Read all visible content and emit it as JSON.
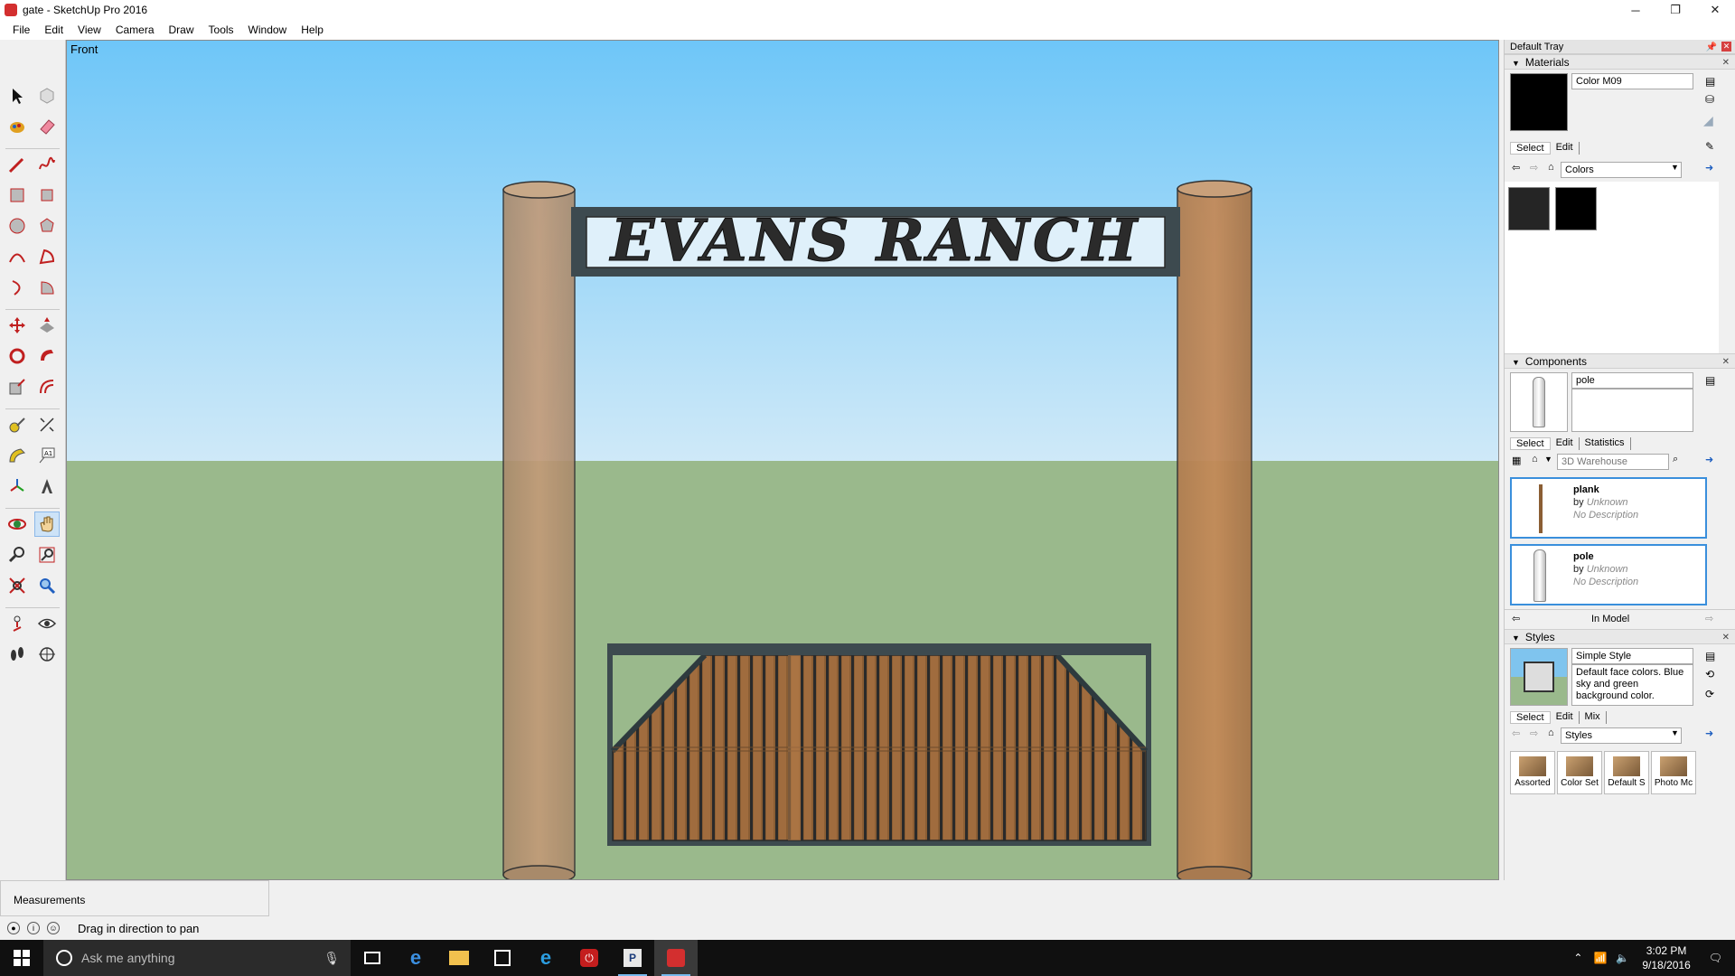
{
  "window": {
    "title": "gate - SketchUp Pro 2016",
    "controls": {
      "minimize": "─",
      "maximize": "❐",
      "close": "✕"
    }
  },
  "menu": [
    "File",
    "Edit",
    "View",
    "Camera",
    "Draw",
    "Tools",
    "Window",
    "Help"
  ],
  "viewport": {
    "scene_label": "Front",
    "sign_text": "EVANS RANCH",
    "colors": {
      "sky_top": "#6ec6f8",
      "sky_bottom": "#cfe9f8",
      "ground": "#9ab98c",
      "post": "#b98e66",
      "frame": "#3d4a4f",
      "plank": "#8b5e34"
    }
  },
  "tray": {
    "title": "Default Tray",
    "materials": {
      "header": "Materials",
      "current_name": "Color M09",
      "tabs": [
        "Select",
        "Edit"
      ],
      "library": "Colors",
      "swatches": [
        "#252525",
        "#000000"
      ]
    },
    "components": {
      "header": "Components",
      "current_name": "pole",
      "tabs": [
        "Select",
        "Edit",
        "Statistics"
      ],
      "search_placeholder": "3D Warehouse",
      "items": [
        {
          "name": "plank",
          "by_label": "by",
          "author": "Unknown",
          "desc": "No Description"
        },
        {
          "name": "pole",
          "by_label": "by",
          "author": "Unknown",
          "desc": "No Description"
        }
      ],
      "in_model_label": "In Model"
    },
    "styles": {
      "header": "Styles",
      "current_name": "Simple Style",
      "description": "Default face colors. Blue sky and green background color.",
      "tabs": [
        "Select",
        "Edit",
        "Mix"
      ],
      "library": "Styles",
      "thumbs": [
        "Assorted",
        "Color Set",
        "Default S",
        "Photo Mc"
      ]
    }
  },
  "measurements_label": "Measurements",
  "status": {
    "text": "Drag in direction to pan"
  },
  "taskbar": {
    "search_placeholder": "Ask me anything",
    "time": "3:02 PM",
    "date": "9/18/2016"
  }
}
